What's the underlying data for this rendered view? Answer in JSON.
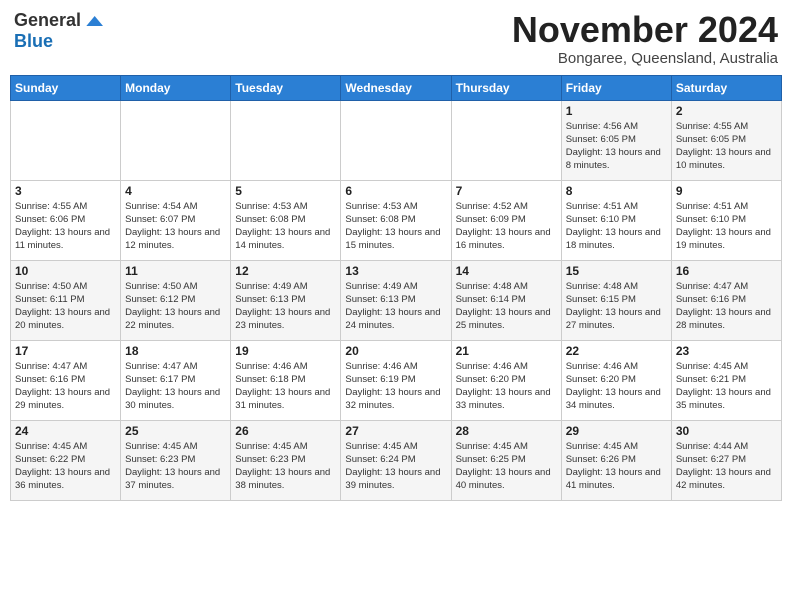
{
  "header": {
    "logo_general": "General",
    "logo_blue": "Blue",
    "month_title": "November 2024",
    "location": "Bongaree, Queensland, Australia"
  },
  "weekdays": [
    "Sunday",
    "Monday",
    "Tuesday",
    "Wednesday",
    "Thursday",
    "Friday",
    "Saturday"
  ],
  "weeks": [
    [
      {
        "day": "",
        "info": ""
      },
      {
        "day": "",
        "info": ""
      },
      {
        "day": "",
        "info": ""
      },
      {
        "day": "",
        "info": ""
      },
      {
        "day": "",
        "info": ""
      },
      {
        "day": "1",
        "info": "Sunrise: 4:56 AM\nSunset: 6:05 PM\nDaylight: 13 hours and 8 minutes."
      },
      {
        "day": "2",
        "info": "Sunrise: 4:55 AM\nSunset: 6:05 PM\nDaylight: 13 hours and 10 minutes."
      }
    ],
    [
      {
        "day": "3",
        "info": "Sunrise: 4:55 AM\nSunset: 6:06 PM\nDaylight: 13 hours and 11 minutes."
      },
      {
        "day": "4",
        "info": "Sunrise: 4:54 AM\nSunset: 6:07 PM\nDaylight: 13 hours and 12 minutes."
      },
      {
        "day": "5",
        "info": "Sunrise: 4:53 AM\nSunset: 6:08 PM\nDaylight: 13 hours and 14 minutes."
      },
      {
        "day": "6",
        "info": "Sunrise: 4:53 AM\nSunset: 6:08 PM\nDaylight: 13 hours and 15 minutes."
      },
      {
        "day": "7",
        "info": "Sunrise: 4:52 AM\nSunset: 6:09 PM\nDaylight: 13 hours and 16 minutes."
      },
      {
        "day": "8",
        "info": "Sunrise: 4:51 AM\nSunset: 6:10 PM\nDaylight: 13 hours and 18 minutes."
      },
      {
        "day": "9",
        "info": "Sunrise: 4:51 AM\nSunset: 6:10 PM\nDaylight: 13 hours and 19 minutes."
      }
    ],
    [
      {
        "day": "10",
        "info": "Sunrise: 4:50 AM\nSunset: 6:11 PM\nDaylight: 13 hours and 20 minutes."
      },
      {
        "day": "11",
        "info": "Sunrise: 4:50 AM\nSunset: 6:12 PM\nDaylight: 13 hours and 22 minutes."
      },
      {
        "day": "12",
        "info": "Sunrise: 4:49 AM\nSunset: 6:13 PM\nDaylight: 13 hours and 23 minutes."
      },
      {
        "day": "13",
        "info": "Sunrise: 4:49 AM\nSunset: 6:13 PM\nDaylight: 13 hours and 24 minutes."
      },
      {
        "day": "14",
        "info": "Sunrise: 4:48 AM\nSunset: 6:14 PM\nDaylight: 13 hours and 25 minutes."
      },
      {
        "day": "15",
        "info": "Sunrise: 4:48 AM\nSunset: 6:15 PM\nDaylight: 13 hours and 27 minutes."
      },
      {
        "day": "16",
        "info": "Sunrise: 4:47 AM\nSunset: 6:16 PM\nDaylight: 13 hours and 28 minutes."
      }
    ],
    [
      {
        "day": "17",
        "info": "Sunrise: 4:47 AM\nSunset: 6:16 PM\nDaylight: 13 hours and 29 minutes."
      },
      {
        "day": "18",
        "info": "Sunrise: 4:47 AM\nSunset: 6:17 PM\nDaylight: 13 hours and 30 minutes."
      },
      {
        "day": "19",
        "info": "Sunrise: 4:46 AM\nSunset: 6:18 PM\nDaylight: 13 hours and 31 minutes."
      },
      {
        "day": "20",
        "info": "Sunrise: 4:46 AM\nSunset: 6:19 PM\nDaylight: 13 hours and 32 minutes."
      },
      {
        "day": "21",
        "info": "Sunrise: 4:46 AM\nSunset: 6:20 PM\nDaylight: 13 hours and 33 minutes."
      },
      {
        "day": "22",
        "info": "Sunrise: 4:46 AM\nSunset: 6:20 PM\nDaylight: 13 hours and 34 minutes."
      },
      {
        "day": "23",
        "info": "Sunrise: 4:45 AM\nSunset: 6:21 PM\nDaylight: 13 hours and 35 minutes."
      }
    ],
    [
      {
        "day": "24",
        "info": "Sunrise: 4:45 AM\nSunset: 6:22 PM\nDaylight: 13 hours and 36 minutes."
      },
      {
        "day": "25",
        "info": "Sunrise: 4:45 AM\nSunset: 6:23 PM\nDaylight: 13 hours and 37 minutes."
      },
      {
        "day": "26",
        "info": "Sunrise: 4:45 AM\nSunset: 6:23 PM\nDaylight: 13 hours and 38 minutes."
      },
      {
        "day": "27",
        "info": "Sunrise: 4:45 AM\nSunset: 6:24 PM\nDaylight: 13 hours and 39 minutes."
      },
      {
        "day": "28",
        "info": "Sunrise: 4:45 AM\nSunset: 6:25 PM\nDaylight: 13 hours and 40 minutes."
      },
      {
        "day": "29",
        "info": "Sunrise: 4:45 AM\nSunset: 6:26 PM\nDaylight: 13 hours and 41 minutes."
      },
      {
        "day": "30",
        "info": "Sunrise: 4:44 AM\nSunset: 6:27 PM\nDaylight: 13 hours and 42 minutes."
      }
    ]
  ]
}
